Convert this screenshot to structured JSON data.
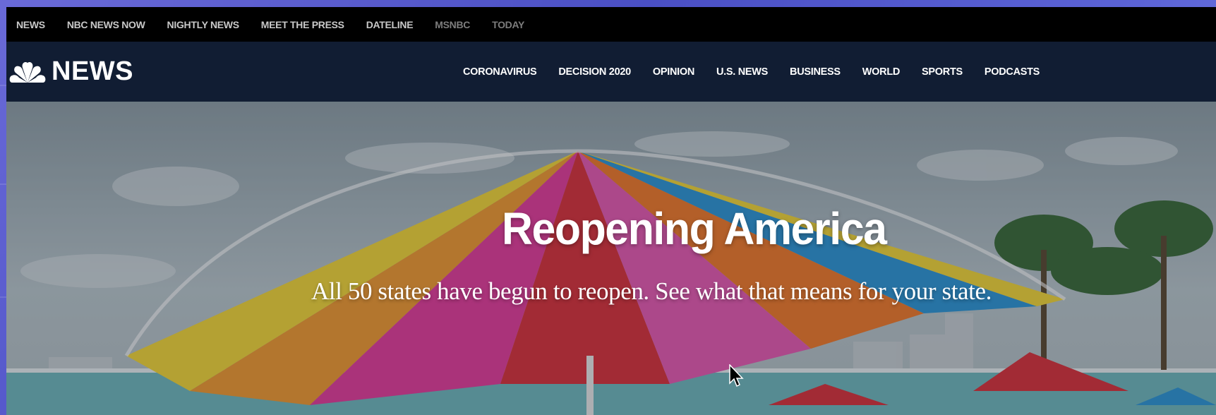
{
  "top_bar": {
    "links": [
      {
        "label": "NEWS",
        "dim": false
      },
      {
        "label": "NBC NEWS NOW",
        "dim": false
      },
      {
        "label": "NIGHTLY NEWS",
        "dim": false
      },
      {
        "label": "MEET THE PRESS",
        "dim": false
      },
      {
        "label": "DATELINE",
        "dim": false
      },
      {
        "label": "MSNBC",
        "dim": true
      },
      {
        "label": "TODAY",
        "dim": true
      }
    ]
  },
  "header": {
    "logo_text": "NEWS",
    "logo_icon": "nbc-peacock-icon",
    "nav": [
      "CORONAVIRUS",
      "DECISION 2020",
      "OPINION",
      "U.S. NEWS",
      "BUSINESS",
      "WORLD",
      "SPORTS",
      "PODCASTS"
    ]
  },
  "hero": {
    "title": "Reopening America",
    "subtitle": "All 50 states have begun to reopen. See what that means for your state."
  },
  "colors": {
    "top_bar_bg": "#000000",
    "nav_bg": "#111d33",
    "text_white": "#ffffff",
    "top_link": "#c9c9c9",
    "top_link_dim": "#7d7d7d"
  }
}
